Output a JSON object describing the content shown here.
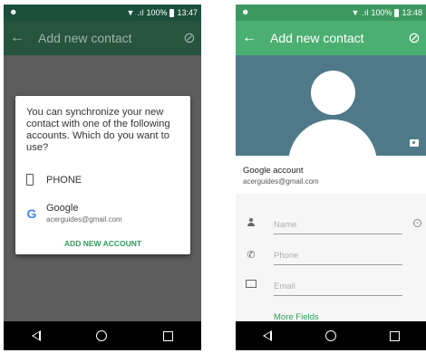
{
  "left_screen": {
    "status": {
      "battery": "100%",
      "time": "13:47"
    },
    "appbar": {
      "title": "Add new contact"
    },
    "dialog": {
      "message": "You can synchronize your new contact with one of the following accounts. Which do you want to use?",
      "option_phone": "PHONE",
      "option_google": "Google",
      "option_google_email": "acerguides@gmail.com",
      "add_account": "ADD NEW ACCOUNT"
    }
  },
  "right_screen": {
    "status": {
      "battery": "100%",
      "time": "13:48"
    },
    "appbar": {
      "title": "Add new contact"
    },
    "account": {
      "title": "Google account",
      "email": "acerguides@gmail.com"
    },
    "fields": {
      "name_placeholder": "Name",
      "phone_placeholder": "Phone",
      "email_placeholder": "Email"
    },
    "more_fields": "More Fields"
  },
  "colors": {
    "accent": "#4caf72",
    "statusbar": "#3d9a5f",
    "photo_bg": "#4f7988",
    "link": "#2e9d5c"
  },
  "icons": [
    "back-arrow-icon",
    "check-circle-icon",
    "wifi-icon",
    "signal-icon",
    "battery-icon",
    "phone-icon",
    "google-icon",
    "person-icon",
    "phone-call-icon",
    "mail-icon",
    "camera-icon",
    "nav-back-icon",
    "nav-home-icon",
    "nav-recents-icon"
  ]
}
